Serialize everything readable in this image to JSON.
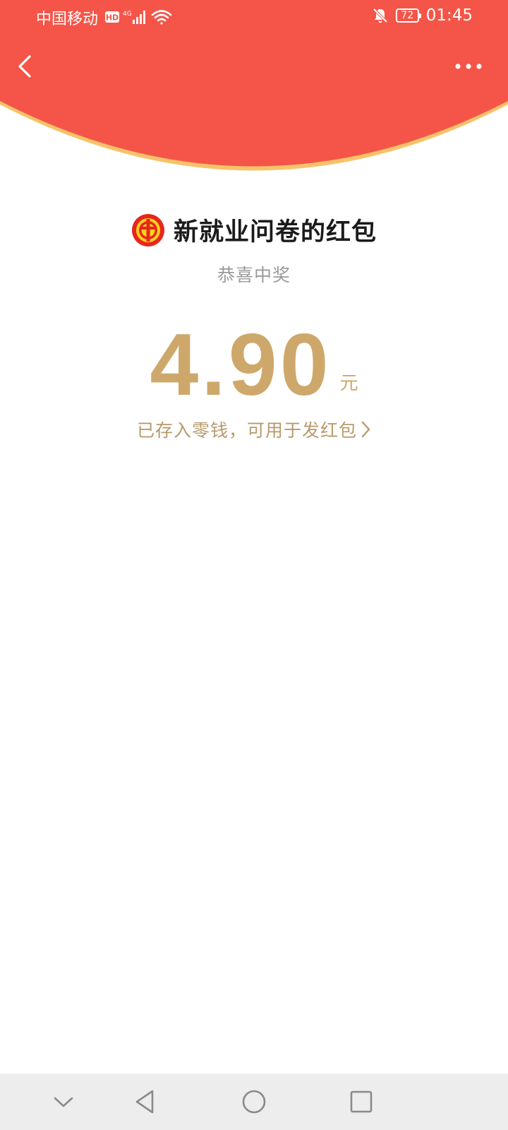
{
  "status_bar": {
    "carrier": "中国移动",
    "hd_badge": "HD",
    "network": "4G",
    "battery_level": "72",
    "time": "01:45",
    "icons": [
      "hd-icon",
      "signal-icon",
      "wifi-icon",
      "mute-bell-icon",
      "battery-icon"
    ]
  },
  "nav": {
    "back_icon": "chevron-left-icon",
    "more_icon": "more-dots-icon"
  },
  "colors": {
    "header_red": "#f55548",
    "header_border": "#f7c36a",
    "amount_gold": "#cea86b",
    "link_gold": "#b79a6c"
  },
  "red_packet": {
    "sender_logo": "union-emblem-icon",
    "title": "新就业问卷的红包",
    "subtitle": "恭喜中奖",
    "amount": "4.90",
    "currency": "元",
    "wallet_text": "已存入零钱，可用于发红包"
  },
  "system_nav": {
    "buttons": [
      "collapse-icon",
      "back-triangle-icon",
      "home-circle-icon",
      "recents-square-icon"
    ]
  }
}
